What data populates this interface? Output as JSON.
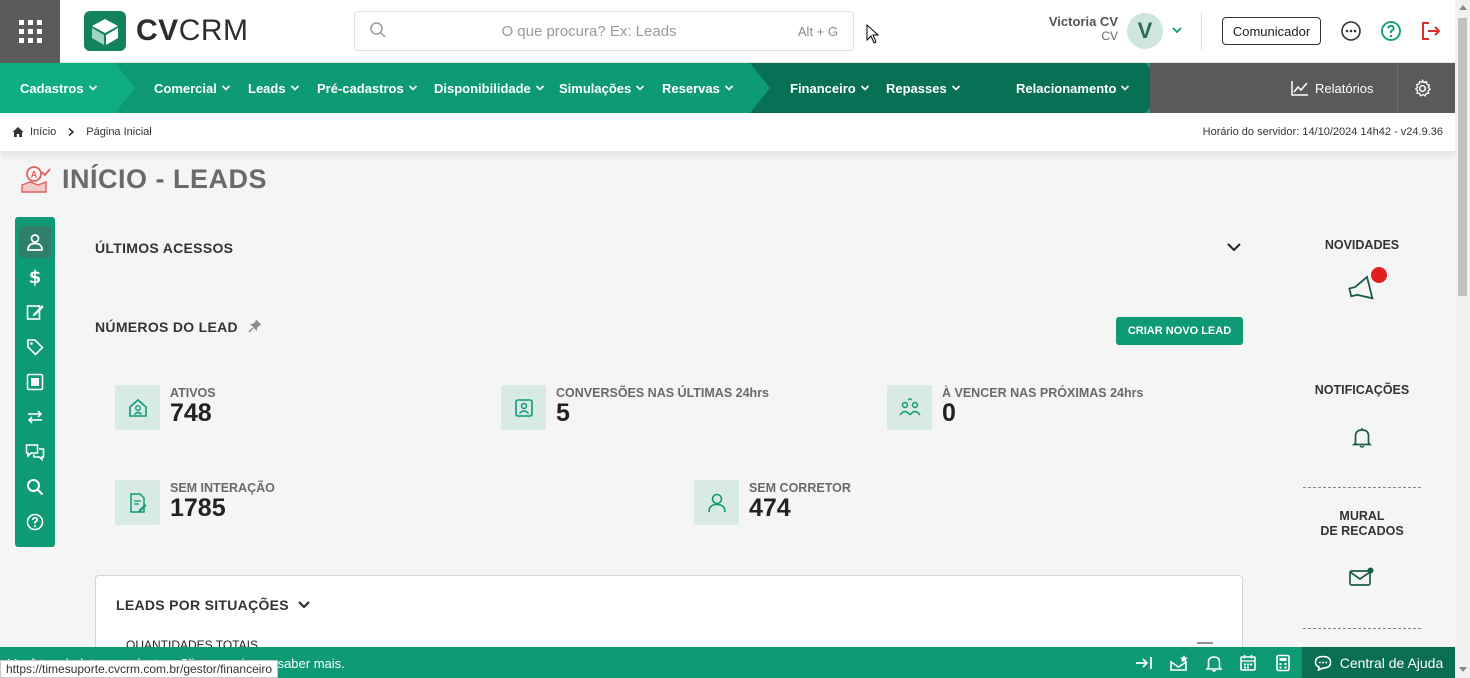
{
  "header": {
    "logo_text_bold": "CV",
    "logo_text_regular": "CRM",
    "search_placeholder": "O que procura? Ex: Leads",
    "search_shortcut": "Alt + G",
    "user_name": "Victoria CV",
    "user_role": "CV",
    "avatar_letter": "V",
    "comunicador_label": "Comunicador"
  },
  "nav": {
    "items": [
      {
        "label": "Cadastros"
      },
      {
        "label": "Comercial"
      },
      {
        "label": "Leads"
      },
      {
        "label": "Pré-cadastros"
      },
      {
        "label": "Disponibilidade"
      },
      {
        "label": "Simulações"
      },
      {
        "label": "Reservas"
      },
      {
        "label": "Financeiro"
      },
      {
        "label": "Repasses"
      },
      {
        "label": "Relacionamento"
      }
    ],
    "reports_label": "Relatórios"
  },
  "breadcrumb": {
    "home": "Início",
    "current": "Página Inicial",
    "server_time": "Horário do servidor: 14/10/2024 14h42 - v24.9.36"
  },
  "page": {
    "title": "INÍCIO - LEADS"
  },
  "main": {
    "ultimos_acessos": "ÚLTIMOS ACESSOS",
    "numeros_title": "NÚMEROS DO LEAD",
    "new_lead_button": "CRIAR NOVO LEAD",
    "stats": [
      {
        "label": "ATIVOS",
        "value": "748"
      },
      {
        "label": "CONVERSÕES NAS ÚLTIMAS 24hrs",
        "value": "5"
      },
      {
        "label": "À VENCER NAS PRÓXIMAS 24hrs",
        "value": "0"
      },
      {
        "label": "SEM INTERAÇÃO",
        "value": "1785"
      },
      {
        "label": "SEM CORRETOR",
        "value": "474"
      }
    ],
    "situacoes_title": "LEADS POR SITUAÇÕES",
    "quantidades_label": "QUANTIDADES TOTAIS"
  },
  "right": {
    "novidades": "NOVIDADES",
    "notificacoes": "NOTIFICAÇÕES",
    "mural_line1": "MURAL",
    "mural_line2": "DE RECADOS"
  },
  "bottom": {
    "message": "Você tem boletos pendentes. Clique aqui para saber mais.",
    "status_url": "https://timesuporte.cvcrm.com.br/gestor/financeiro",
    "help_label": "Central de Ajuda"
  },
  "colors": {
    "primary": "#0d9a74",
    "dark_green": "#0a6e53",
    "notification_dot": "#e02020",
    "logout": "#d93025"
  }
}
